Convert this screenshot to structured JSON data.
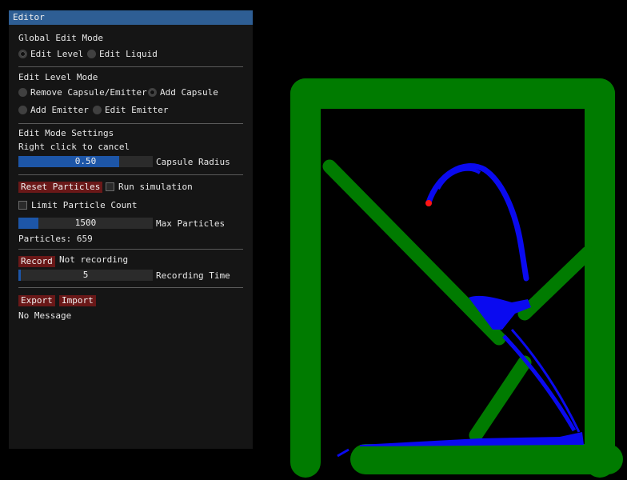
{
  "window": {
    "title": "Editor"
  },
  "global_mode": {
    "heading": "Global Edit Mode",
    "options": [
      "Edit Level",
      "Edit Liquid"
    ],
    "selected": 0
  },
  "level_mode": {
    "heading": "Edit Level Mode",
    "options": [
      "Remove Capsule/Emitter",
      "Add Capsule",
      "Add Emitter",
      "Edit Emitter"
    ],
    "selected": 1
  },
  "settings": {
    "heading": "Edit Mode Settings",
    "hint": "Right click to cancel",
    "capsule_radius": {
      "value": "0.50",
      "label": "Capsule Radius",
      "fraction": 0.75
    }
  },
  "simulation": {
    "reset_label": "Reset Particles",
    "run_label": "Run simulation",
    "run_checked": false,
    "limit_label": "Limit Particle Count",
    "limit_checked": false,
    "max_particles": {
      "value": "1500",
      "label": "Max Particles",
      "fraction": 0.15
    },
    "particles_text": "Particles: 659"
  },
  "recording": {
    "record_label": "Record",
    "status": "Not recording",
    "time": {
      "value": "5",
      "label": "Recording Time",
      "fraction": 0.02
    }
  },
  "io": {
    "export_label": "Export",
    "import_label": "Import",
    "message": "No Message"
  },
  "colors": {
    "capsule": "#007b00",
    "liquid": "#0a0af0",
    "emitter": "#ff1414",
    "background": "#000000",
    "panel": "#151515",
    "titlebar": "#2e5e94",
    "button": "#6a1818",
    "slider_fill": "#1d56a8"
  }
}
